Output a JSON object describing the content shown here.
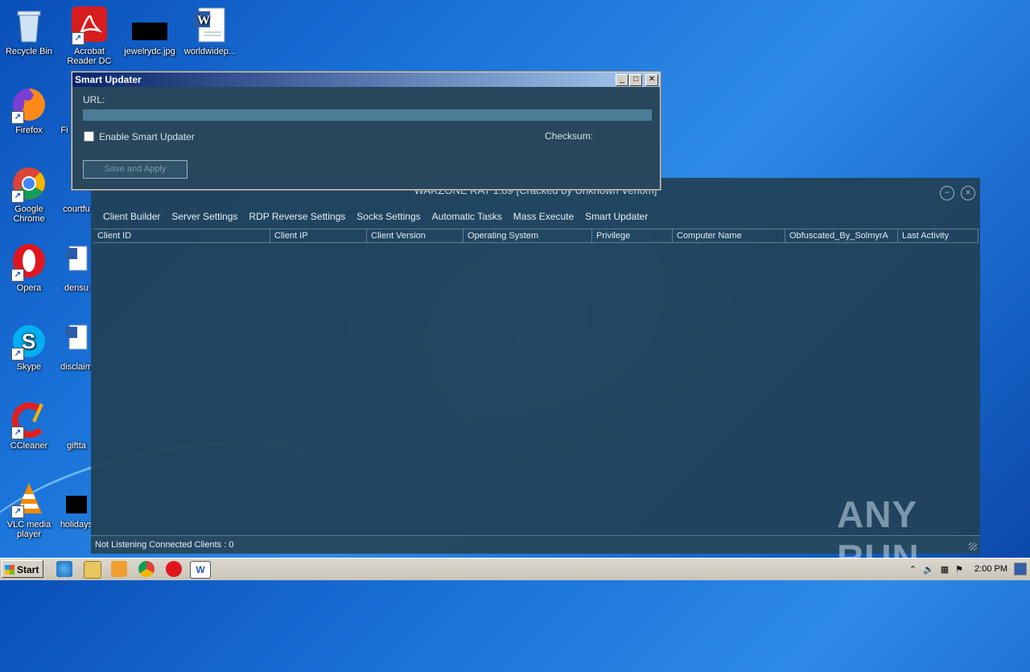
{
  "desktop": {
    "icons": [
      {
        "label": "Recycle Bin"
      },
      {
        "label": "Acrobat Reader DC"
      },
      {
        "label": "jewelrydc.jpg"
      },
      {
        "label": "worldwidep..."
      },
      {
        "label": "Firefox"
      },
      {
        "label": "Fi"
      },
      {
        "label": "Google Chrome"
      },
      {
        "label": "courtfu"
      },
      {
        "label": "Opera"
      },
      {
        "label": "densu"
      },
      {
        "label": "Skype"
      },
      {
        "label": "disclaim"
      },
      {
        "label": "CCleaner"
      },
      {
        "label": "giftta"
      },
      {
        "label": "VLC media player"
      },
      {
        "label": "holidays"
      }
    ]
  },
  "rat_window": {
    "title": "WARZONE RAT 1.89 [Cracked by Unknown Venom]",
    "menu": [
      "Client Builder",
      "Server Settings",
      "RDP Reverse Settings",
      "Socks Settings",
      "Automatic Tasks",
      "Mass Execute",
      "Smart Updater"
    ],
    "columns": [
      "Client ID",
      "Client IP",
      "Client Version",
      "Operating System",
      "Privilege",
      "Computer Name",
      "Obfuscated_By_SolmyrA",
      "Last Activity"
    ],
    "status": "Not Listening   Connected Clients : 0",
    "minimize_icon": "minimize-circle-icon",
    "close_icon": "close-circle-icon"
  },
  "smart_updater": {
    "title": "Smart Updater",
    "url_label": "URL:",
    "url_value": "",
    "enable_label": "Enable Smart Updater",
    "enable_checked": false,
    "checksum_label": "Checksum:",
    "save_label": "Save and Apply"
  },
  "watermark": "ANY RUN",
  "taskbar": {
    "start_label": "Start",
    "clock": "2:00 PM",
    "quick_icons": [
      "ie-icon",
      "explorer-icon",
      "media-player-icon",
      "chrome-icon",
      "opera-icon",
      "word-icon"
    ]
  },
  "colors": {
    "rat_bg": "#214258",
    "dialog_bg": "#28475d",
    "caption_start": "#0a246a",
    "caption_end": "#a6caf0"
  }
}
